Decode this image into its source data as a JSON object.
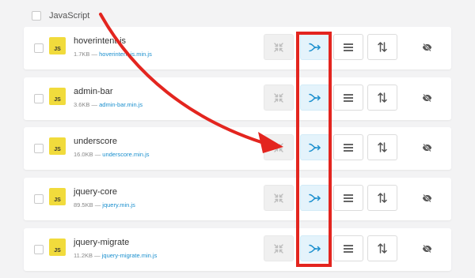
{
  "group": {
    "title": "JavaScript"
  },
  "rows": [
    {
      "name": "hoverintent-js",
      "size": "1.7KB",
      "separator": "—",
      "file": "hoverintent-js.min.js",
      "badge": "JS"
    },
    {
      "name": "admin-bar",
      "size": "3.6KB",
      "separator": "—",
      "file": "admin-bar.min.js",
      "badge": "JS"
    },
    {
      "name": "underscore",
      "size": "16.0KB",
      "separator": "—",
      "file": "underscore.min.js",
      "badge": "JS"
    },
    {
      "name": "jquery-core",
      "size": "89.5KB",
      "separator": "—",
      "file": "jquery.min.js",
      "badge": "JS"
    },
    {
      "name": "jquery-migrate",
      "size": "11.2KB",
      "separator": "—",
      "file": "jquery-migrate.min.js",
      "badge": "JS"
    }
  ],
  "colors": {
    "annotation": "#e3251f",
    "js_badge": "#f1db3c",
    "link": "#1a8fce",
    "defer_active_bg": "#e4f3fb",
    "defer_icon": "#1a8fce"
  },
  "icons": {
    "minify": "compress-icon",
    "defer": "defer-arrow-icon",
    "inline": "lines-icon",
    "move": "sort-arrows-icon",
    "hide": "eye-slash-icon"
  }
}
